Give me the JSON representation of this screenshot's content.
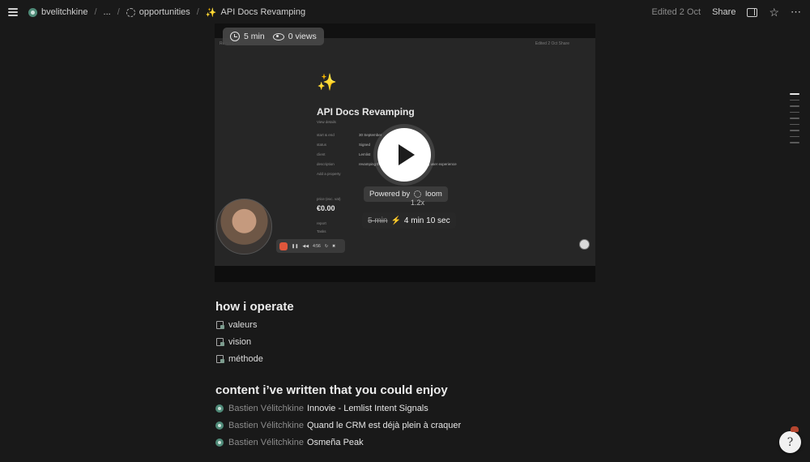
{
  "topbar": {
    "breadcrumbs": [
      {
        "label": "bvelitchkine",
        "icon": "workspace-icon"
      },
      {
        "label": "...",
        "icon": ""
      },
      {
        "label": "opportunities",
        "icon": "dashed-circle-icon"
      },
      {
        "label": "API Docs Revamping",
        "icon": "magic-wand-icon"
      }
    ],
    "edited": "Edited 2 Oct",
    "share_label": "Share"
  },
  "video": {
    "duration": "5 min",
    "views": "0 views",
    "inner": {
      "breadcrumb": "Revamping",
      "right_text": "Edited 2 Oct   Share",
      "title": "API Docs Revamping",
      "subtitle": "View details",
      "properties": [
        {
          "label": "start & end",
          "value": "30 September"
        },
        {
          "label": "status",
          "value": "Signed"
        },
        {
          "label": "client",
          "value": "Lemlist"
        },
        {
          "label": "description",
          "value": "revamping the api documentation improving user experience"
        },
        {
          "label": "Add a property",
          "value": ""
        }
      ],
      "price_label": "price (exc. vat)",
      "price": "€0.00",
      "items": [
        "report",
        "Tasks"
      ]
    },
    "powered_by": "Powered by",
    "loom_label": "loom",
    "speed_ghost": "1.2x",
    "speed_old": "5 min",
    "speed_new": "4 min 10 sec",
    "rec_time": "4:56"
  },
  "sections": {
    "operate": {
      "heading": "how i operate",
      "items": [
        "valeurs",
        "vision",
        "méthode"
      ]
    },
    "content": {
      "heading": "content i’ve written that you could enjoy",
      "items": [
        {
          "author": "Bastien Vélitchkine",
          "title": "Innovie - Lemlist Intent Signals"
        },
        {
          "author": "Bastien Vélitchkine",
          "title": "Quand le CRM est déjà plein à craquer"
        },
        {
          "author": "Bastien Vélitchkine",
          "title": "Osmeña Peak"
        }
      ]
    }
  },
  "colors": {
    "background": "#191919",
    "accent_green": "#4f8a78",
    "rec_red": "#e0563b",
    "bolt_yellow": "#f5c542"
  }
}
